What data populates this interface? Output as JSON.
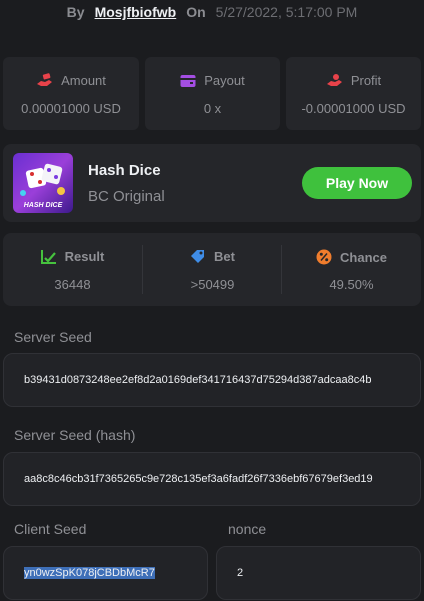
{
  "byline": {
    "by": "By",
    "user": "Mosjfbiofwb",
    "on": "On",
    "date": "5/27/2022, 5:17:00 PM"
  },
  "stats": [
    {
      "label": "Amount",
      "value": "0.00001000 USD",
      "icon": "money-hand-icon",
      "color": "#e8424a"
    },
    {
      "label": "Payout",
      "value": "0 x",
      "icon": "wallet-icon",
      "color": "#a44ee3"
    },
    {
      "label": "Profit",
      "value": "-0.00001000 USD",
      "icon": "profit-hand-icon",
      "color": "#e8424a"
    }
  ],
  "game": {
    "title": "Hash Dice",
    "subtitle": "BC Original",
    "thumb_text": "HASH DICE",
    "play_label": "Play Now"
  },
  "result": [
    {
      "label": "Result",
      "value": "36448",
      "icon": "check-chart-icon",
      "color": "#46c23e"
    },
    {
      "label": "Bet",
      "value": ">50499",
      "icon": "tag-icon",
      "color": "#3f8de8"
    },
    {
      "label": "Chance",
      "value": "49.50%",
      "icon": "percent-icon",
      "color": "#f07d2d"
    }
  ],
  "seeds": {
    "server_label": "Server Seed",
    "server_value": "b39431d0873248ee2ef8d2a0169def341716437d75294d387adcaa8c4b",
    "server_hash_label": "Server Seed (hash)",
    "server_hash_value": "aa8c8c46cb31f7365265c9e728c135ef3a6fadf26f7336ebf67679ef3ed19",
    "client_label": "Client Seed",
    "client_value": "yn0wzSpK078jCBDbMcR7",
    "nonce_label": "nonce",
    "nonce_value": "2"
  }
}
